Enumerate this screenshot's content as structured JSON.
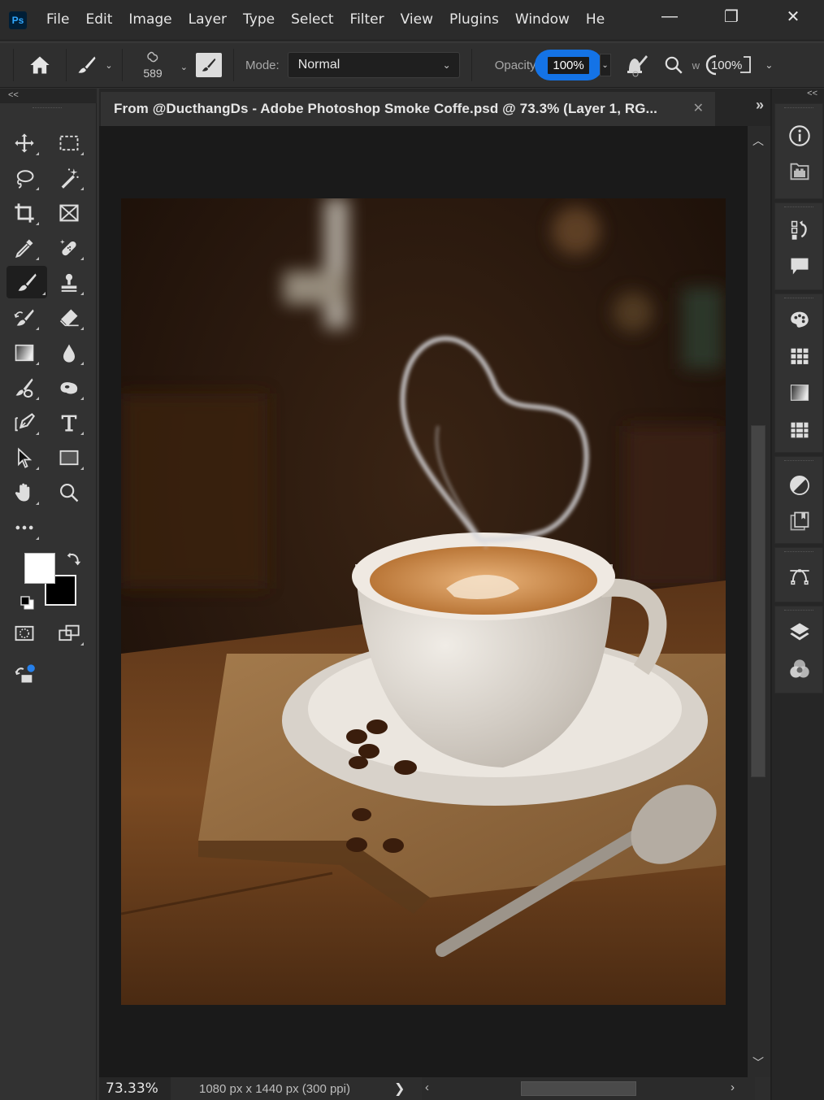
{
  "app": {
    "logo": "Ps",
    "menu": [
      "File",
      "Edit",
      "Image",
      "Layer",
      "Type",
      "Select",
      "Filter",
      "View",
      "Plugins",
      "Window",
      "He"
    ],
    "window_controls": {
      "minimize": "—",
      "restore": "❐",
      "close": "✕"
    }
  },
  "options_bar": {
    "brush_size": "589",
    "mode_label": "Mode:",
    "mode_value": "Normal",
    "opacity_label": "Opacity",
    "opacity_value": "100%",
    "flow_label": "w",
    "flow_value": "100%",
    "accent_color": "#1473e6"
  },
  "panels": {
    "left_collapse": "<<",
    "right_collapse": "<<"
  },
  "document": {
    "tab_title": "From @DucthangDs - Adobe Photoshop Smoke Coffe.psd @ 73.3% (Layer 1, RG...",
    "close_glyph": "✕",
    "more_glyph": "»",
    "image_description": "Coffee cup with heart-shaped steam on burlap cloth, coffee beans and spoon"
  },
  "status": {
    "zoom": "73.33%",
    "doc_info": "1080 px x 1440 px (300 ppi)",
    "next_glyph": "❯"
  },
  "tools": [
    {
      "name": "move-tool",
      "icon": "move-icon"
    },
    {
      "name": "marquee-tool",
      "icon": "rectangular-marquee-icon"
    },
    {
      "name": "lasso-tool",
      "icon": "lasso-icon"
    },
    {
      "name": "magic-wand-tool",
      "icon": "magic-wand-icon"
    },
    {
      "name": "crop-tool",
      "icon": "crop-icon"
    },
    {
      "name": "frame-tool",
      "icon": "frame-icon"
    },
    {
      "name": "eyedropper-tool",
      "icon": "eyedropper-icon"
    },
    {
      "name": "healing-brush-tool",
      "icon": "bandage-icon"
    },
    {
      "name": "brush-tool",
      "icon": "brush-icon",
      "active": true
    },
    {
      "name": "clone-stamp-tool",
      "icon": "stamp-icon"
    },
    {
      "name": "history-brush-tool",
      "icon": "history-brush-icon"
    },
    {
      "name": "eraser-tool",
      "icon": "eraser-icon"
    },
    {
      "name": "gradient-tool",
      "icon": "gradient-icon"
    },
    {
      "name": "blur-tool",
      "icon": "drop-icon"
    },
    {
      "name": "dodge-tool",
      "icon": "dodge-icon"
    },
    {
      "name": "sponge-tool",
      "icon": "sponge-icon"
    },
    {
      "name": "pen-tool",
      "icon": "pen-icon"
    },
    {
      "name": "type-tool",
      "icon": "type-icon"
    },
    {
      "name": "path-selection-tool",
      "icon": "arrow-icon"
    },
    {
      "name": "rectangle-tool",
      "icon": "rectangle-icon"
    },
    {
      "name": "hand-tool",
      "icon": "hand-icon"
    },
    {
      "name": "zoom-tool",
      "icon": "magnifier-icon"
    },
    {
      "name": "edit-toolbar",
      "icon": "more-icon"
    }
  ],
  "colors": {
    "foreground": "#ffffff",
    "background": "#000000"
  },
  "right_panel_icons": [
    "info-icon",
    "libraries-icon",
    "history-icon",
    "comments-icon",
    "color-palette-icon",
    "swatches-icon",
    "gradients-icon",
    "patterns-icon",
    "adjustments-icon",
    "styles-icon",
    "paths-icon",
    "layers-icon",
    "channels-icon"
  ]
}
